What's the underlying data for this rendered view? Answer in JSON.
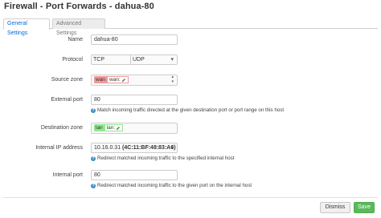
{
  "title": "Firewall - Port Forwards - dahua-80",
  "tabs": [
    {
      "label": "General Settings",
      "active": true
    },
    {
      "label": "Advanced Settings",
      "active": false
    }
  ],
  "fields": {
    "name": {
      "label": "Name",
      "value": "dahua-80"
    },
    "protocol": {
      "label": "Protocol",
      "values": [
        "TCP",
        "UDP"
      ]
    },
    "source_zone": {
      "label": "Source zone",
      "zone": "wan",
      "sub": "wan:",
      "color": "#f09a9a"
    },
    "external_port": {
      "label": "External port",
      "value": "80",
      "help": "Match incoming traffic directed at the given destination port or port range on this host"
    },
    "destination_zone": {
      "label": "Destination zone",
      "zone": "lan",
      "sub": "lan:",
      "color": "#90e890"
    },
    "internal_ip": {
      "label": "Internal IP address",
      "ip": "10.16.0.31",
      "mac": "(4C:11:BF:48:83:A6)",
      "help": "Redirect matched incoming traffic to the specified internal host"
    },
    "internal_port": {
      "label": "Internal port",
      "value": "80",
      "help": "Redirect matched incoming traffic to the given port on the internal host"
    }
  },
  "buttons": {
    "dismiss": "Dismiss",
    "save": "Save"
  }
}
